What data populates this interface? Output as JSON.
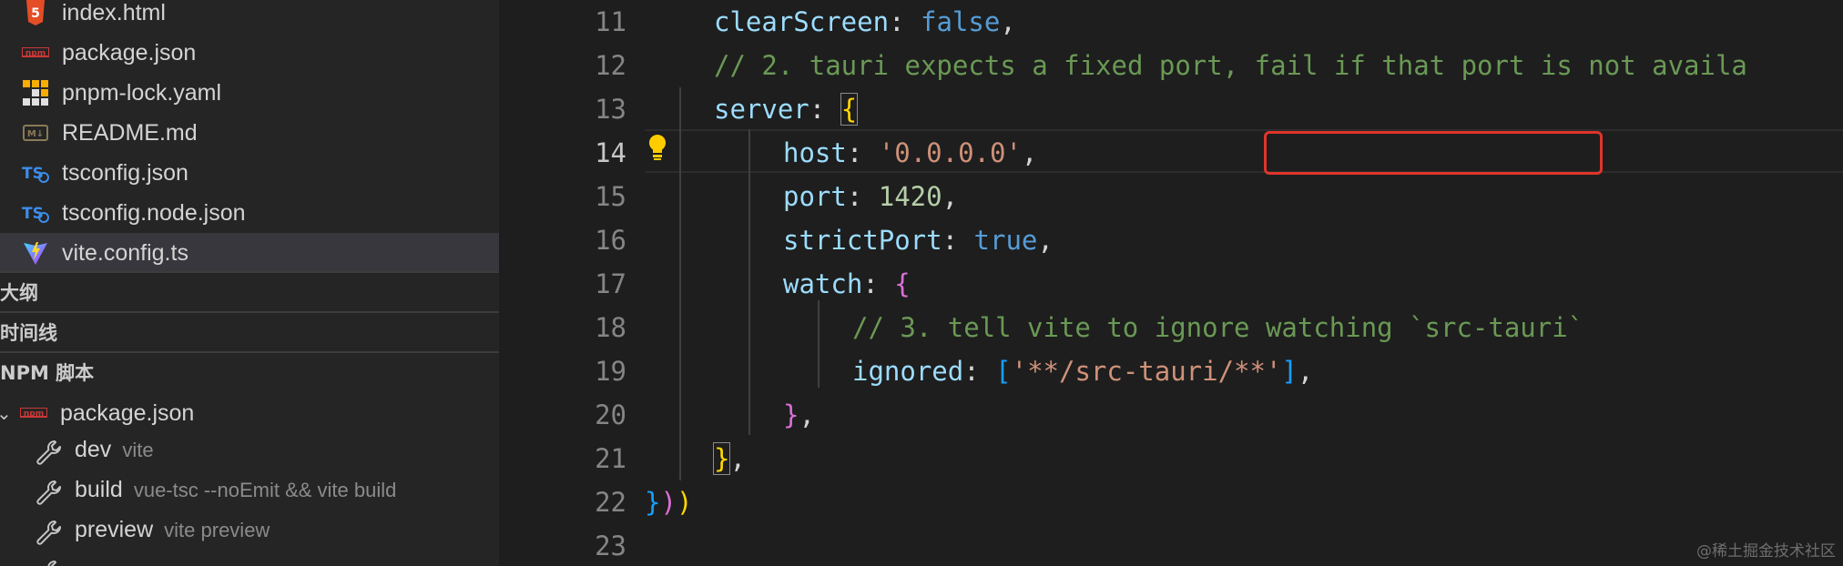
{
  "explorer": {
    "files": [
      {
        "name": "index.html",
        "icon": "html5-icon"
      },
      {
        "name": "package.json",
        "icon": "npm-icon"
      },
      {
        "name": "pnpm-lock.yaml",
        "icon": "pnpm-icon"
      },
      {
        "name": "README.md",
        "icon": "markdown-icon"
      },
      {
        "name": "tsconfig.json",
        "icon": "typescript-config-icon"
      },
      {
        "name": "tsconfig.node.json",
        "icon": "typescript-config-icon"
      },
      {
        "name": "vite.config.ts",
        "icon": "vite-icon",
        "selected": true
      }
    ],
    "sections": {
      "outline": "大纲",
      "timeline": "时间线",
      "npm_scripts": "NPM 脚本"
    },
    "npm": {
      "package": "package.json",
      "scripts": [
        {
          "name": "dev",
          "command": "vite"
        },
        {
          "name": "build",
          "command": "vue-tsc --noEmit && vite build"
        },
        {
          "name": "preview",
          "command": "vite preview"
        }
      ]
    }
  },
  "editor": {
    "active_line": "14",
    "line_numbers": [
      "11",
      "12",
      "13",
      "14",
      "15",
      "16",
      "17",
      "18",
      "19",
      "20",
      "21",
      "22",
      "23"
    ],
    "code": {
      "l11_key": "clearScreen",
      "l11_val": "false",
      "l12_comment": "// 2. tauri expects a fixed port, fail if that port is not availa",
      "l13_key": "server",
      "l14_key": "host",
      "l14_val": "'0.0.0.0'",
      "l15_key": "port",
      "l15_val": "1420",
      "l16_key": "strictPort",
      "l16_val": "true",
      "l17_key": "watch",
      "l18_comment": "// 3. tell vite to ignore watching `src-tauri`",
      "l19_key": "ignored",
      "l19_val": "'**/src-tauri/**'"
    }
  },
  "watermark": "@稀土掘金技术社区",
  "colors": {
    "highlight_box": "#e0342a",
    "property": "#9cdcfe",
    "comment": "#6a9955",
    "string": "#ce9178",
    "number": "#b5cea8",
    "boolean": "#569cd6"
  }
}
